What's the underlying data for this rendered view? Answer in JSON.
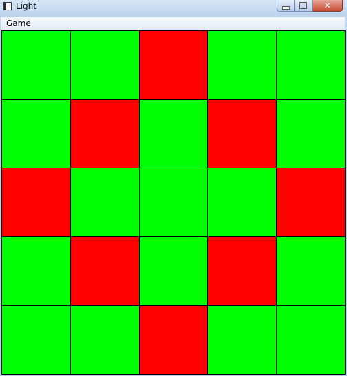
{
  "window": {
    "title": "Light",
    "controls": {
      "minimize": "minimize-icon",
      "maximize": "maximize-icon",
      "close": "close-icon"
    }
  },
  "menu": {
    "items": [
      {
        "label": "Game"
      }
    ]
  },
  "board": {
    "rows": 5,
    "cols": 5,
    "colors": {
      "on": "#ff0000",
      "off": "#00ff00",
      "grid": "#000000"
    },
    "cells": [
      [
        "green",
        "green",
        "red",
        "green",
        "green"
      ],
      [
        "green",
        "red",
        "green",
        "red",
        "green"
      ],
      [
        "red",
        "green",
        "green",
        "green",
        "red"
      ],
      [
        "green",
        "red",
        "green",
        "red",
        "green"
      ],
      [
        "green",
        "green",
        "red",
        "green",
        "green"
      ]
    ]
  }
}
